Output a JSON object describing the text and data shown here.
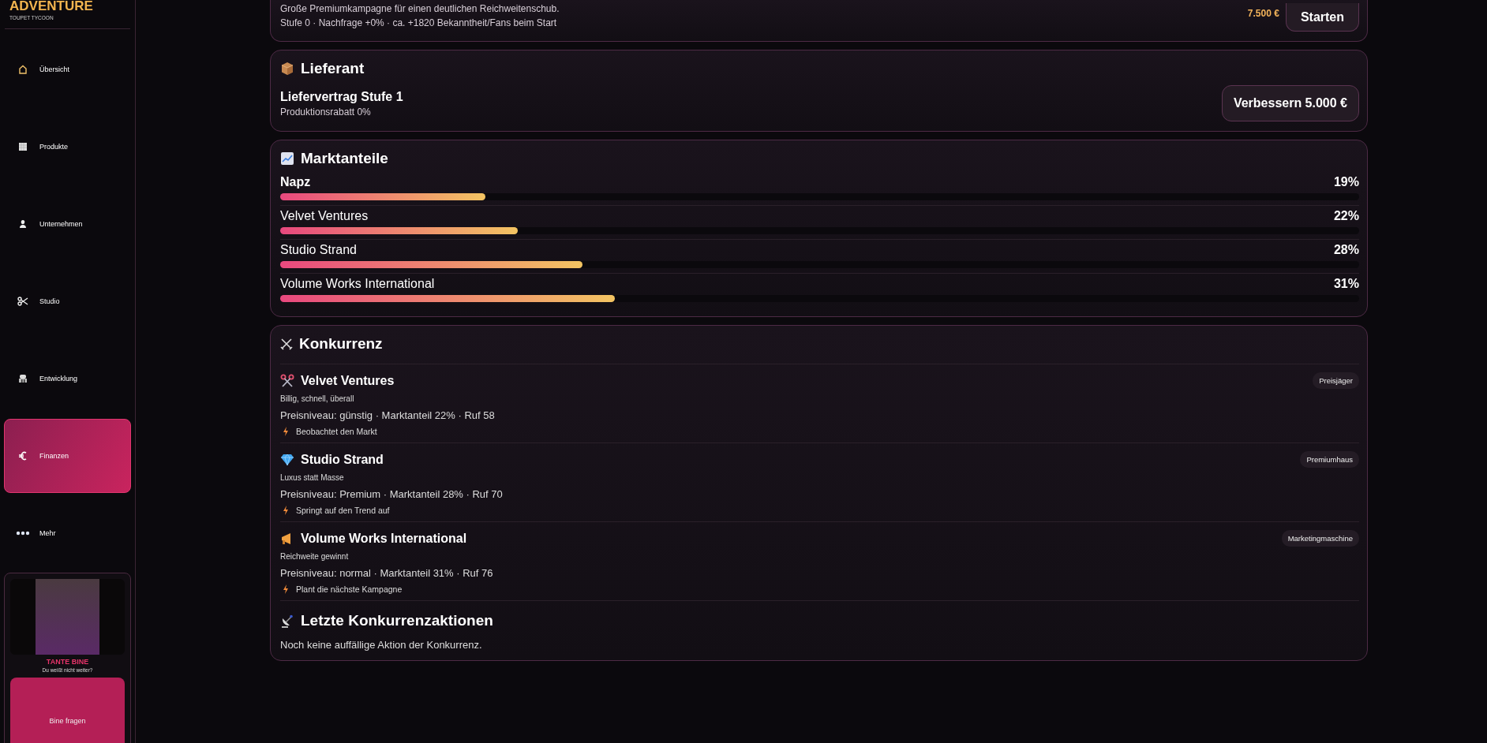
{
  "sidebar": {
    "brand": "ADVENTURE",
    "subtitle": "TOUPET TYCOON",
    "nav": [
      {
        "label": "Übersicht",
        "selected": false
      },
      {
        "label": "Produkte",
        "selected": false
      },
      {
        "label": "Unternehmen",
        "selected": false
      },
      {
        "label": "Studio",
        "selected": false
      },
      {
        "label": "Entwicklung",
        "selected": false
      },
      {
        "label": "Finanzen",
        "selected": true
      },
      {
        "label": "Mehr",
        "selected": false
      }
    ],
    "advisor": {
      "name": "TANTE BINE",
      "prompt": "Du weißt nicht weiter?",
      "button": "Bine fragen"
    }
  },
  "campaign": {
    "description": "Große Premiumkampagne für einen deutlichen Reichweitenschub.",
    "details": "Stufe 0 · Nachfrage +0% · ca. +1820 Bekanntheit/Fans beim Start",
    "price": "7.500 €",
    "button": "Starten"
  },
  "supplier": {
    "title": "Lieferant",
    "contract": "Liefervertrag Stufe 1",
    "discount": "Produktionsrabatt 0%",
    "button": "Verbessern 5.000 €"
  },
  "market_share": {
    "title": "Marktanteile",
    "rows": [
      {
        "name": "Napz",
        "value": "19%",
        "level": 0.19,
        "highlighted": true
      },
      {
        "name": "Velvet Ventures",
        "value": "22%",
        "level": 0.22,
        "highlighted": false
      },
      {
        "name": "Studio Strand",
        "value": "28%",
        "level": 0.28,
        "highlighted": false
      },
      {
        "name": "Volume Works International",
        "value": "31%",
        "level": 0.31,
        "highlighted": false
      }
    ]
  },
  "competition": {
    "title": "Konkurrenz",
    "rivals": [
      {
        "name": "Velvet Ventures",
        "tag": "Preisjäger",
        "tagline": "Billig, schnell, überall",
        "stats": "Preisniveau: günstig · Marktanteil 22% · Ruf 58",
        "activity": "Beobachtet den Markt"
      },
      {
        "name": "Studio Strand",
        "tag": "Premiumhaus",
        "tagline": "Luxus statt Masse",
        "stats": "Preisniveau: Premium · Marktanteil 28% · Ruf 70",
        "activity": "Springt auf den Trend auf"
      },
      {
        "name": "Volume Works International",
        "tag": "Marketingmaschine",
        "tagline": "Reichweite gewinnt",
        "stats": "Preisniveau: normal · Marktanteil 31% · Ruf 76",
        "activity": "Plant die nächste Kampagne"
      }
    ],
    "recent": {
      "title": "Letzte Konkurrenzaktionen",
      "text": "Noch keine auffällige Aktion der Konkurrenz."
    }
  }
}
